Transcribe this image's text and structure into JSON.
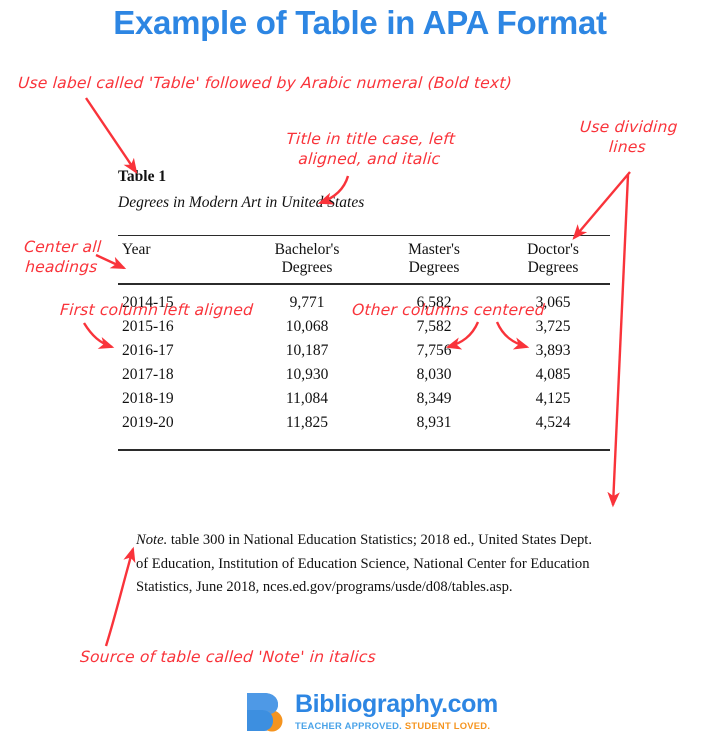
{
  "page": {
    "title": "Example of Table in APA Format",
    "title_color": "#2d86e3",
    "annotation_color": "#f9333a"
  },
  "table": {
    "label": "Table 1",
    "caption": "Degrees in Modern Art in United States",
    "headers": [
      "Year",
      "Bachelor's\nDegrees",
      "Master's\nDegrees",
      "Doctor's\nDegrees"
    ],
    "header_year": "Year",
    "header_bachelors_line1": "Bachelor's",
    "header_bachelors_line2": "Degrees",
    "header_masters_line1": "Master's",
    "header_masters_line2": "Degrees",
    "header_doctors_line1": "Doctor's",
    "header_doctors_line2": "Degrees",
    "rows": [
      {
        "year": "2014-15",
        "bachelors": "9,771",
        "masters": "6,582",
        "doctors": "3,065"
      },
      {
        "year": "2015-16",
        "bachelors": "10,068",
        "masters": "7,582",
        "doctors": "3,725"
      },
      {
        "year": "2016-17",
        "bachelors": "10,187",
        "masters": "7,756",
        "doctors": "3,893"
      },
      {
        "year": "2017-18",
        "bachelors": "10,930",
        "masters": "8,030",
        "doctors": "4,085"
      },
      {
        "year": "2018-19",
        "bachelors": "11,084",
        "masters": "8,349",
        "doctors": "4,125"
      },
      {
        "year": "2019-20",
        "bachelors": "11,825",
        "masters": "8,931",
        "doctors": "4,524"
      }
    ],
    "note_label": "Note.",
    "note_body": " table 300 in National Education Statistics; 2018 ed., United States Dept. of Education, Institution of Education Science, National Center for Education Statistics, June 2018, nces.ed.gov/programs/usde/d08/tables.asp."
  },
  "annotations": {
    "top_label": "Use label called 'Table' followed by Arabic numeral (Bold text)",
    "title_case": "Title in title case, left\naligned, and italic",
    "dividing_lines": "Use dividing\nlines",
    "center_headings": "Center all\nheadings",
    "first_column": "First column left aligned",
    "other_columns": "Other columns centered",
    "source_note": "Source of table called 'Note' in italics"
  },
  "logo": {
    "word": "Bibliography.com",
    "tagline_blue": "TEACHER APPROVED.",
    "tagline_orange": "STUDENT LOVED.",
    "mark_blue": "#3d8fe0",
    "mark_orange": "#f5941f"
  }
}
